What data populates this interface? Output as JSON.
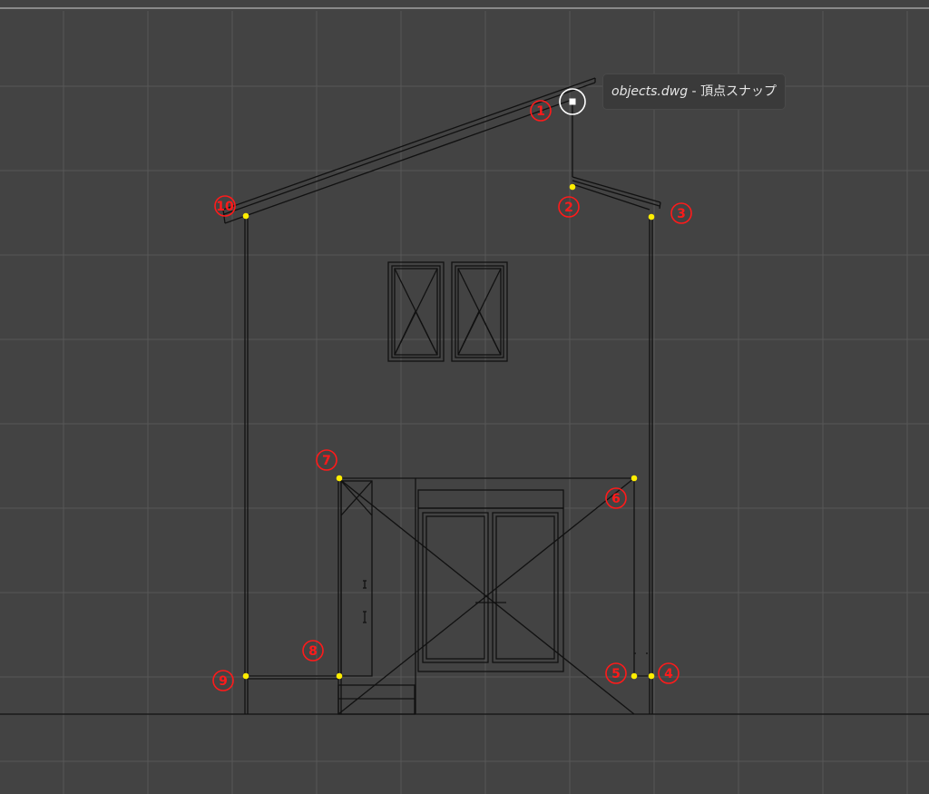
{
  "tooltip": {
    "file_name": "objects.dwg",
    "separator": " - ",
    "snap_mode": "頂点スナップ"
  },
  "markers": [
    {
      "id": "1",
      "label": "1"
    },
    {
      "id": "2",
      "label": "2"
    },
    {
      "id": "3",
      "label": "3"
    },
    {
      "id": "4",
      "label": "4"
    },
    {
      "id": "5",
      "label": "5"
    },
    {
      "id": "6",
      "label": "6"
    },
    {
      "id": "7",
      "label": "7"
    },
    {
      "id": "8",
      "label": "8"
    },
    {
      "id": "9",
      "label": "9"
    },
    {
      "id": "10",
      "label": "10"
    }
  ],
  "colors": {
    "background": "#434343",
    "grid": "#5a5a5a",
    "lines": "#111111",
    "vertex_dot": "#ffee00",
    "marker": "#ff1a1a",
    "snap_cursor": "#ffffff"
  },
  "icons": {
    "snap_cursor": "vertex-snap-cursor-icon",
    "vertex": "vertex-point-icon"
  }
}
